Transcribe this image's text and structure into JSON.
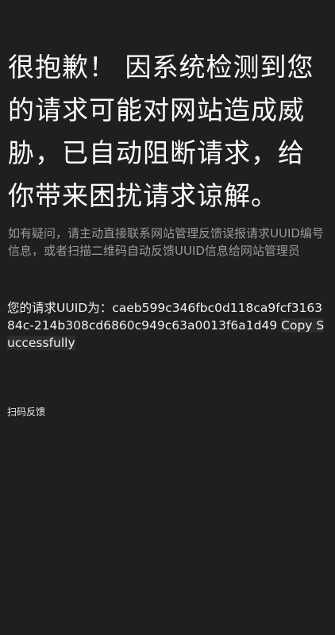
{
  "block_page": {
    "headline": "很抱歉！ 因系统检测到您的请求可能对网站造成威胁，已自动阻断请求，给你带来困扰请求谅解。",
    "notice": "如有疑问，请主动直接联系网站管理反馈误报请求UUID编号信息，或者扫描二维码自动反馈UUID信息给网站管理员",
    "uuid_prefix": "您的请求UUID为：",
    "uuid_value": "caeb599c346fbc0d118ca9fcf316384c-214b308cd6860c949c63a0013f6a1d49",
    "copy_status": "Copy Successfully",
    "scan_feedback_link": "扫码反馈"
  },
  "colors": {
    "background": "#1f1f1f",
    "headline": "#ffffff",
    "notice": "#9a9a9a",
    "body_text": "#f2f2f2"
  }
}
